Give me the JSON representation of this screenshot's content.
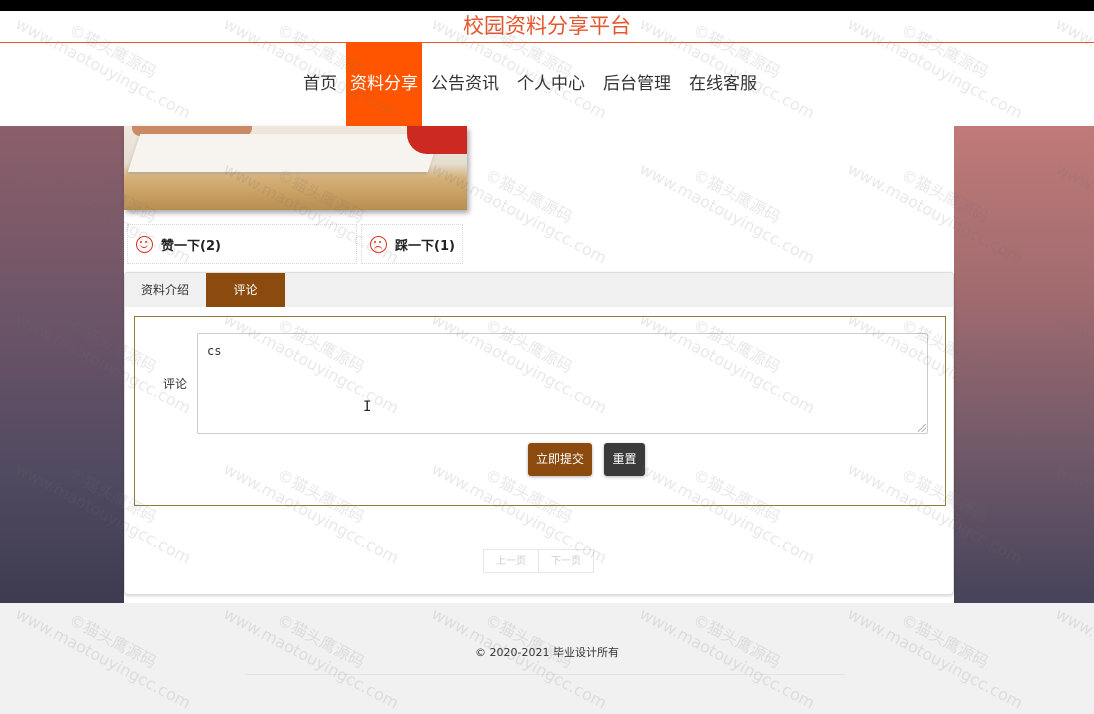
{
  "site": {
    "title": "校园资料分享平台"
  },
  "nav": {
    "items": [
      {
        "label": "首页"
      },
      {
        "label": "资料分享",
        "active": true
      },
      {
        "label": "公告资讯"
      },
      {
        "label": "个人中心"
      },
      {
        "label": "后台管理"
      },
      {
        "label": "在线客服"
      }
    ]
  },
  "votes": {
    "like_label": "赞一下(2)",
    "dislike_label": "踩一下(1)"
  },
  "tabs": {
    "intro_label": "资料介绍",
    "comment_label": "评论"
  },
  "comment_form": {
    "label": "评论",
    "value": "cs",
    "submit_label": "立即提交",
    "reset_label": "重置"
  },
  "pager": {
    "prev_label": "上一页",
    "next_label": "下一页"
  },
  "footer": {
    "copyright": "© 2020-2021 毕业设计所有"
  },
  "watermark": {
    "line1": "©猫头鹰源码",
    "line2": "www.maotouyingcc.com"
  },
  "colors": {
    "accent": "#ff5500",
    "brand_brown": "#8b4a0e",
    "title": "#e4572e"
  }
}
